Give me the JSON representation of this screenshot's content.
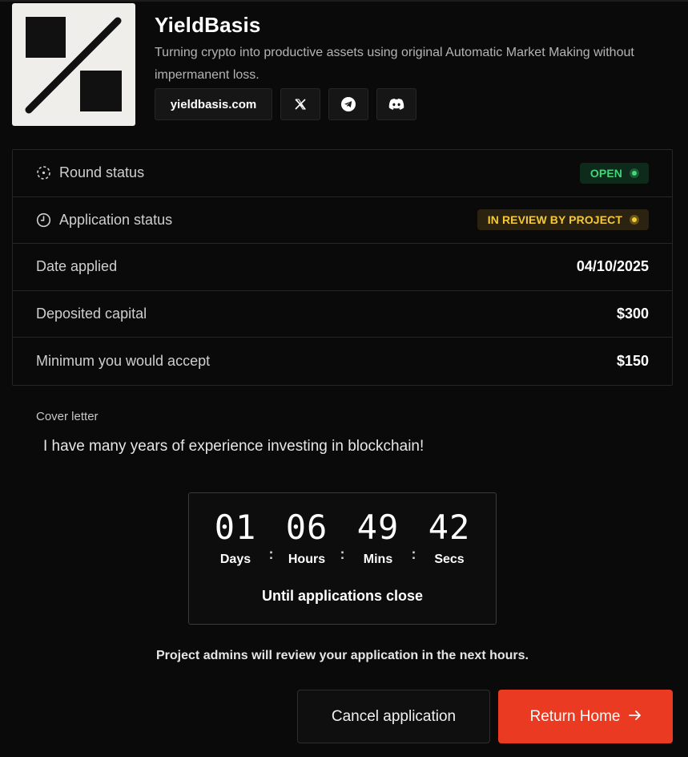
{
  "project": {
    "name": "YieldBasis",
    "description": "Turning crypto into productive assets using original Automatic Market Making without impermanent loss.",
    "links": {
      "website_label": "yieldbasis.com",
      "icons": [
        "x-icon",
        "telegram-icon",
        "discord-icon"
      ]
    }
  },
  "info": {
    "round_status_label": "Round status",
    "round_status_value": "OPEN",
    "application_status_label": "Application status",
    "application_status_value": "IN REVIEW BY PROJECT",
    "date_applied_label": "Date applied",
    "date_applied_value": "04/10/2025",
    "deposited_capital_label": "Deposited capital",
    "deposited_capital_value": "$300",
    "minimum_accept_label": "Minimum you would accept",
    "minimum_accept_value": "$150"
  },
  "cover_letter": {
    "label": "Cover letter",
    "text": "I have many years of experience investing in blockchain!"
  },
  "countdown": {
    "days": "01",
    "hours": "06",
    "mins": "49",
    "secs": "42",
    "days_label": "Days",
    "hours_label": "Hours",
    "mins_label": "Mins",
    "secs_label": "Secs",
    "separator": ":",
    "caption": "Until applications close"
  },
  "review_note": "Project admins will review your application in the next hours.",
  "actions": {
    "cancel_label": "Cancel application",
    "home_label": "Return Home"
  },
  "colors": {
    "background": "#0a0a0a",
    "accent": "#ea3b22",
    "open_green": "#41d47a",
    "review_yellow": "#f3c93a"
  }
}
